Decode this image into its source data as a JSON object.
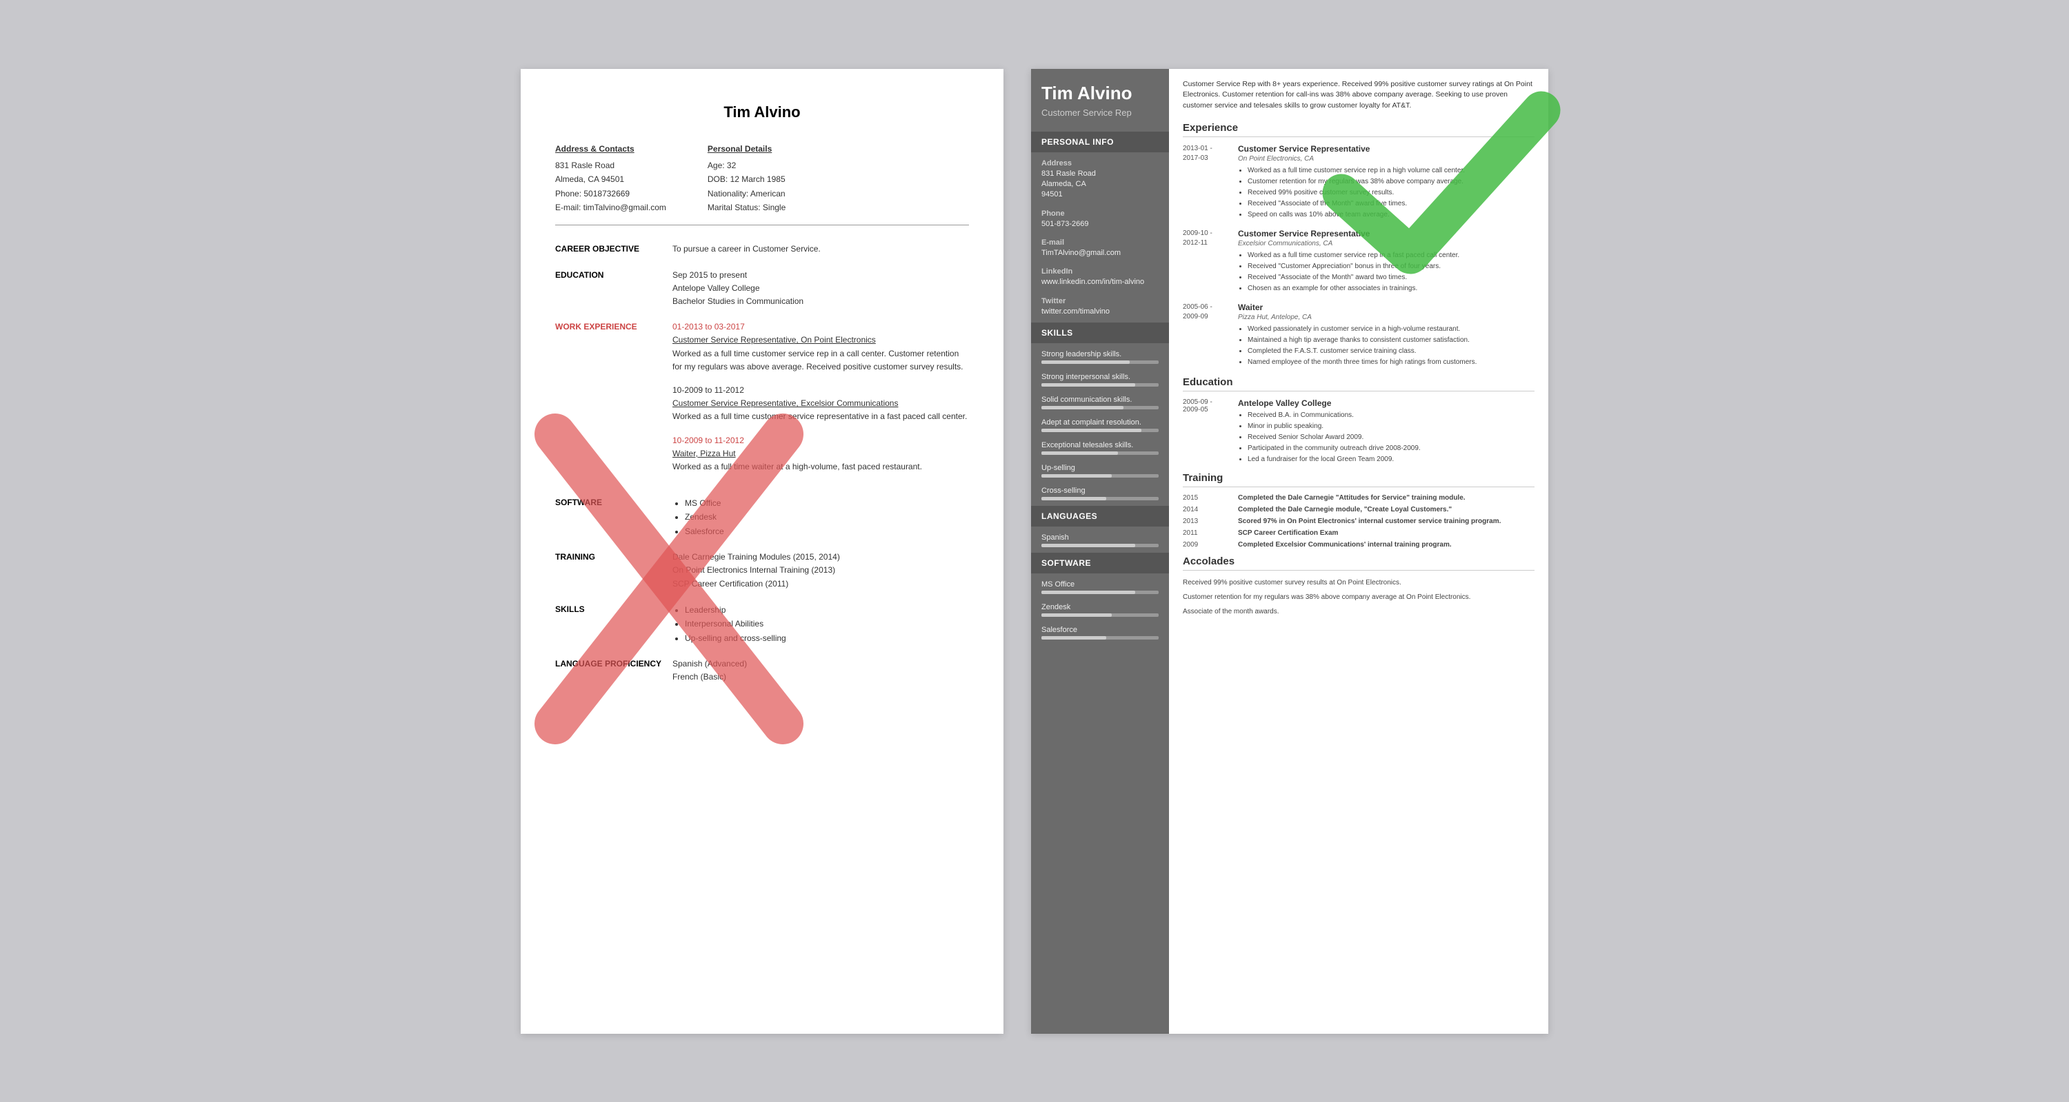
{
  "page": {
    "background_color": "#c8c8cc"
  },
  "left_resume": {
    "name": "Tim Alvino",
    "contact": {
      "left_label": "Address & Contacts",
      "address": "831 Rasle Road",
      "city_state": "Almeda, CA 94501",
      "phone": "Phone: 5018732669",
      "email": "E-mail: timTalvino@gmail.com",
      "right_label": "Personal Details",
      "age": "Age:   32",
      "dob": "DOB:  12 March 1985",
      "nationality": "Nationality: American",
      "marital": "Marital Status: Single"
    },
    "objective_label": "CAREER OBJECTIVE",
    "objective_text": "To pursue a career in Customer Service.",
    "education_label": "EDUCATION",
    "education_dates": "Sep 2015 to present",
    "education_school": "Antelope Valley College",
    "education_degree": "Bachelor Studies in Communication",
    "work_label": "WORK EXPERIENCE",
    "work_items": [
      {
        "dates": "01-2013 to 03-2017",
        "title": "Customer Service Representative, On Point Electronics",
        "description": "Worked as a full time customer service rep in a call center. Customer retention for my regulars was above average. Received positive customer survey results."
      },
      {
        "dates": "10-2009 to 11-2012",
        "title": "Customer Service Representative, Excelsior Communications",
        "description": "Worked as a full time customer service representative in a fast paced call center."
      },
      {
        "dates": "10-2009 to 11-2012",
        "title": "Waiter, Pizza Hut",
        "description": "Worked as a full time waiter at a high-volume, fast paced restaurant."
      }
    ],
    "software_label": "SOFTWARE",
    "software_items": [
      "MS Office",
      "Zendesk",
      "Salesforce"
    ],
    "training_label": "TRAINING",
    "training_items": [
      "Dale Carnegie Training Modules (2015, 2014)",
      "On Point Electronics Internal Training (2013)",
      "SCP Career Certification (2011)"
    ],
    "skills_label": "SKILLS",
    "skills_items": [
      "Leadership",
      "Interpersonal Abilities",
      "Up-selling and cross-selling"
    ],
    "language_label": "LANGUAGE PROFICIENCY",
    "language_items": [
      "Spanish (Advanced)",
      "French (Basic)"
    ]
  },
  "right_resume": {
    "name": "Tim Alvino",
    "title": "Customer Service Rep",
    "objective": "Customer Service Rep with 8+ years experience. Received 99% positive customer survey ratings at On Point Electronics. Customer retention for call-ins was 38% above company average. Seeking to use proven customer service and telesales skills to grow customer loyalty for AT&T.",
    "sidebar": {
      "personal_info_label": "Personal Info",
      "address_label": "Address",
      "address": "831 Rasle Road\nAlameda, CA\n94501",
      "phone_label": "Phone",
      "phone": "501-873-2669",
      "email_label": "E-mail",
      "email": "TimTAlvino@gmail.com",
      "linkedin_label": "LinkedIn",
      "linkedin": "www.linkedin.com/in/tim-alvino",
      "twitter_label": "Twitter",
      "twitter": "twitter.com/timalvino",
      "skills_label": "Skills",
      "skills": [
        {
          "name": "Strong leadership skills.",
          "pct": 75
        },
        {
          "name": "Strong interpersonal skills.",
          "pct": 80
        },
        {
          "name": "Solid communication skills.",
          "pct": 70
        },
        {
          "name": "Adept at complaint resolution.",
          "pct": 85
        },
        {
          "name": "Exceptional telesales skills.",
          "pct": 65
        },
        {
          "name": "Up-selling",
          "pct": 60
        },
        {
          "name": "Cross-selling",
          "pct": 55
        }
      ],
      "languages_label": "Languages",
      "languages": [
        {
          "name": "Spanish",
          "pct": 80
        }
      ],
      "software_label": "Software",
      "software": [
        {
          "name": "MS Office",
          "pct": 80
        },
        {
          "name": "Zendesk",
          "pct": 60
        },
        {
          "name": "Salesforce",
          "pct": 55
        }
      ]
    },
    "experience_label": "Experience",
    "experience": [
      {
        "dates": "2013-01 -\n2017-03",
        "title": "Customer Service Representative",
        "company": "On Point Electronics, CA",
        "bullets": [
          "Worked as a full time customer service rep in a high volume call center.",
          "Customer retention for my regulars was 38% above company average.",
          "Received 99% positive customer survey results.",
          "Received \"Associate of the Month\" award five times.",
          "Speed on calls was 10% above team average."
        ]
      },
      {
        "dates": "2009-10 -\n2012-11",
        "title": "Customer Service Representative",
        "company": "Excelsior Communications, CA",
        "bullets": [
          "Worked as a full time customer service rep in a fast paced call center.",
          "Received \"Customer Appreciation\" bonus in three of four years.",
          "Received \"Associate of the Month\" award two times.",
          "Chosen as an example for other associates in trainings."
        ]
      },
      {
        "dates": "2005-06 -\n2009-09",
        "title": "Waiter",
        "company": "Pizza Hut, Antelope, CA",
        "bullets": [
          "Worked passionately in customer service in a high-volume restaurant.",
          "Maintained a high tip average thanks to consistent customer satisfaction.",
          "Completed the F.A.S.T. customer service training class.",
          "Named employee of the month three times for high ratings from customers."
        ]
      }
    ],
    "education_label": "Education",
    "education": [
      {
        "dates": "2005-09 -\n2009-05",
        "school": "Antelope Valley College",
        "bullets": [
          "Received B.A. in Communications.",
          "Minor in public speaking.",
          "Received Senior Scholar Award 2009.",
          "Participated in the community outreach drive 2008-2009.",
          "Led a fundraiser for the local Green Team 2009."
        ]
      }
    ],
    "training_label": "Training",
    "training": [
      {
        "year": "2015",
        "text": "Completed the Dale Carnegie \"Attitudes for Service\" training module."
      },
      {
        "year": "2014",
        "text": "Completed the Dale Carnegie module, \"Create Loyal Customers.\""
      },
      {
        "year": "2013",
        "text": "Scored 97% in On Point Electronics' internal customer service training program."
      },
      {
        "year": "2011",
        "text": "SCP Career Certification Exam"
      },
      {
        "year": "2009",
        "text": "Completed Excelsior Communications' internal training program."
      }
    ],
    "accolades_label": "Accolades",
    "accolades": [
      "Received 99% positive customer survey results at On Point Electronics.",
      "Customer retention for my regulars was 38% above company average at On Point Electronics.",
      "Associate of the month awards."
    ]
  }
}
